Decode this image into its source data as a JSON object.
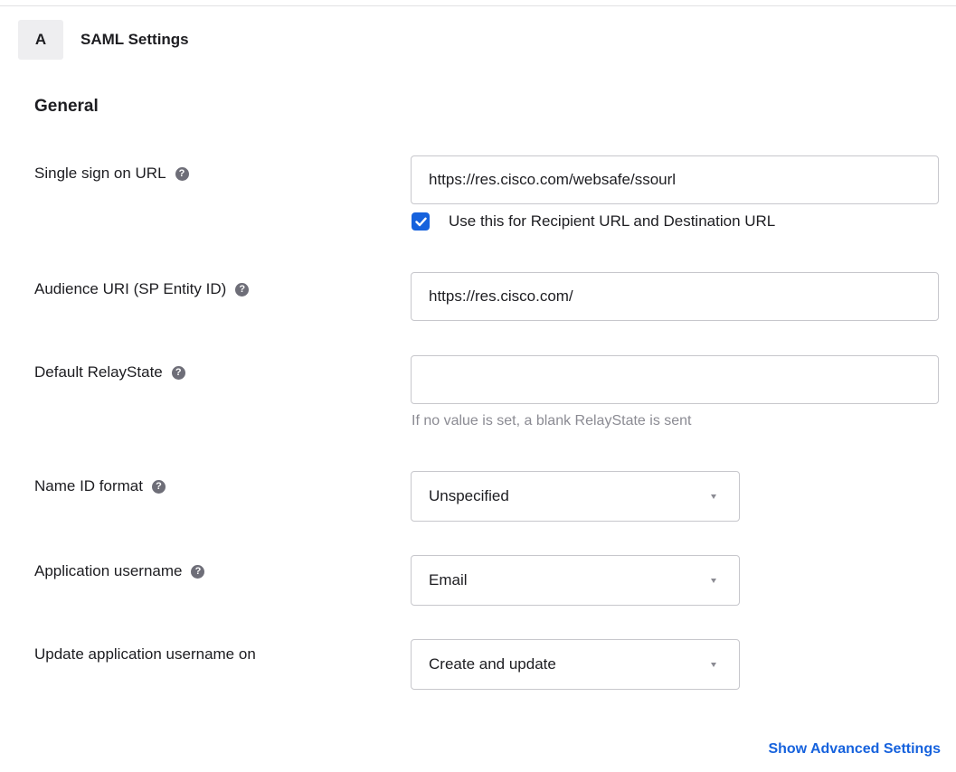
{
  "section": {
    "badge": "A",
    "title": "SAML Settings"
  },
  "general": {
    "title": "General",
    "single_sign_on": {
      "label": "Single sign on URL",
      "value": "https://res.cisco.com/websafe/ssourl",
      "checkbox_label": "Use this for Recipient URL and Destination URL",
      "checkbox_checked": true
    },
    "audience_uri": {
      "label": "Audience URI (SP Entity ID)",
      "value": "https://res.cisco.com/"
    },
    "default_relay_state": {
      "label": "Default RelayState",
      "value": "",
      "hint": "If no value is set, a blank RelayState is sent"
    },
    "name_id_format": {
      "label": "Name ID format",
      "selected": "Unspecified"
    },
    "application_username": {
      "label": "Application username",
      "selected": "Email"
    },
    "update_username_on": {
      "label": "Update application username on",
      "selected": "Create and update"
    }
  },
  "links": {
    "show_advanced": "Show Advanced Settings"
  },
  "colors": {
    "accent": "#1662dd",
    "help_icon": "#6e6e78",
    "badge_bg": "#eeeef0",
    "border": "#c7c7cc",
    "hint_text": "#8b8b93"
  },
  "icons": {
    "help": "help-circle-icon",
    "checkbox": "checkmark-icon",
    "dropdown": "caret-down-icon"
  }
}
